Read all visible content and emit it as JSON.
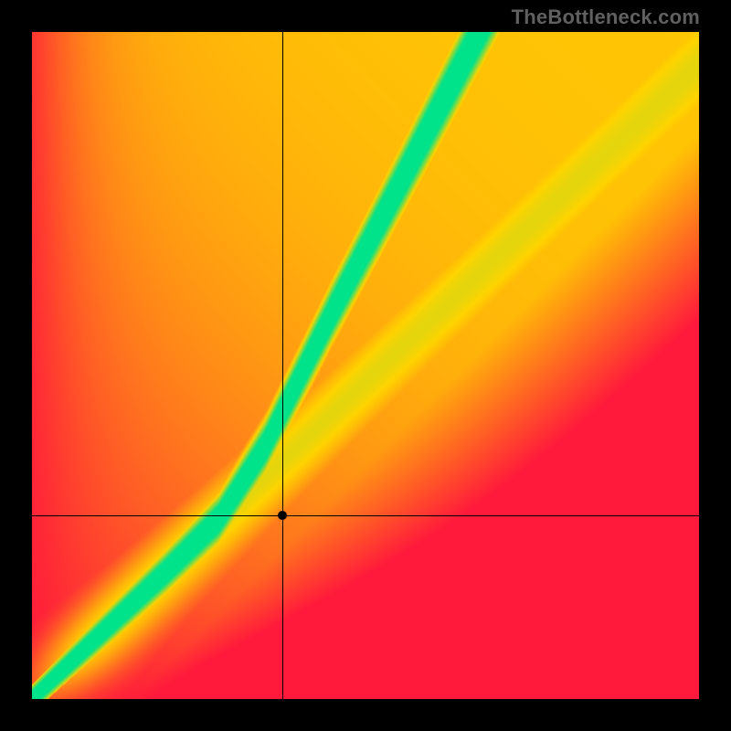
{
  "watermark": "TheBottleneck.com",
  "chart_data": {
    "type": "heatmap",
    "title": "",
    "xlabel": "",
    "ylabel": "",
    "xlim": [
      0,
      1
    ],
    "ylim": [
      0,
      1
    ],
    "marker": {
      "x": 0.375,
      "y": 0.275
    },
    "crosshair": {
      "x": 0.375,
      "y": 0.275
    },
    "optimal_curve": {
      "description": "Green ridge of best balance; piecewise: near-linear y≈x below ~0.28, then steeper y≈1.85x-0.25 above.",
      "samples": [
        {
          "x": 0.0,
          "y": 0.0
        },
        {
          "x": 0.1,
          "y": 0.095
        },
        {
          "x": 0.2,
          "y": 0.19
        },
        {
          "x": 0.28,
          "y": 0.27
        },
        {
          "x": 0.35,
          "y": 0.38
        },
        {
          "x": 0.45,
          "y": 0.58
        },
        {
          "x": 0.55,
          "y": 0.77
        },
        {
          "x": 0.67,
          "y": 1.0
        }
      ]
    },
    "secondary_ridge": {
      "description": "Fainter yellow diagonal ridge roughly y ≈ 0.95x across the field.",
      "samples": [
        {
          "x": 0.0,
          "y": 0.0
        },
        {
          "x": 0.5,
          "y": 0.475
        },
        {
          "x": 1.0,
          "y": 0.95
        }
      ]
    },
    "color_scale": [
      {
        "stop": 0.0,
        "color": "#ff1a3c",
        "meaning": "severe mismatch"
      },
      {
        "stop": 0.5,
        "color": "#ffd400",
        "meaning": "moderate"
      },
      {
        "stop": 1.0,
        "color": "#00e38a",
        "meaning": "optimal"
      }
    ],
    "corners": {
      "top_left": "red",
      "top_right": "yellow",
      "bottom_left": "red",
      "bottom_right": "red"
    }
  },
  "layout": {
    "image_size": 800,
    "plot_inset": 35,
    "plot_size": 730
  }
}
